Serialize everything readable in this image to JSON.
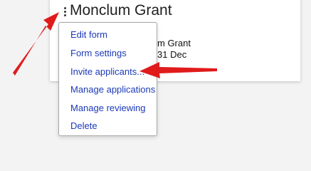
{
  "card": {
    "title": "Monclum Grant",
    "detail_line_1": "m Grant",
    "detail_line_2": "31 Dec"
  },
  "menu": {
    "items": [
      {
        "label": "Edit form"
      },
      {
        "label": "Form settings"
      },
      {
        "label": "Invite applicants..."
      },
      {
        "label": "Manage applications"
      },
      {
        "label": "Manage reviewing"
      },
      {
        "label": "Delete"
      }
    ]
  },
  "colors": {
    "link": "#1c39b8",
    "annotation_arrow": "#e01b1b",
    "menu_border": "#a9a9a9"
  },
  "icons": {
    "card_menu": "kebab-menu-icon"
  }
}
